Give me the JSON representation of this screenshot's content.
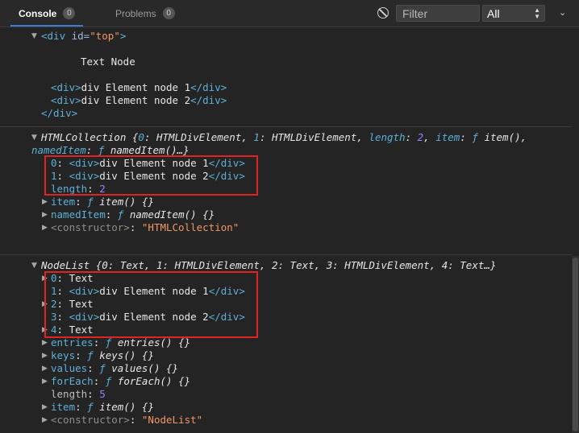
{
  "toolbar": {
    "console_label": "Console",
    "console_count": "0",
    "problems_label": "Problems",
    "problems_count": "0",
    "filter_placeholder": "Filter",
    "level_value": "All"
  },
  "entry1": {
    "line1_tag_open": "<div",
    "line1_attr": " id=",
    "line1_val": "\"top\"",
    "line1_close": ">",
    "text_node": "Text Node",
    "child1_open": "<div>",
    "child1_text": "div Element node 1",
    "child1_close": "</div>",
    "child2_open": "<div>",
    "child2_text": "div Element node 2",
    "child2_close": "</div>",
    "end_tag": "</div>"
  },
  "entry2": {
    "summary_a": "HTMLCollection {",
    "summary_b": "0",
    "summary_c": ": HTMLDivElement, ",
    "summary_d": "1",
    "summary_e": ": HTMLDivElement, ",
    "summary_f": "length",
    "summary_g": ": ",
    "summary_h": "2",
    "summary_i": ", ",
    "summary_j": "item",
    "summary_k": ": ",
    "summary_l": "ƒ",
    "summary_m": " item(),",
    "summary2_a": "namedItem",
    "summary2_b": ": ",
    "summary2_c": "ƒ",
    "summary2_d": " namedItem()…}",
    "items": [
      {
        "key": "0",
        "open": "<div>",
        "text": "div Element node 1",
        "close": "</div>"
      },
      {
        "key": "1",
        "open": "<div>",
        "text": "div Element node 2",
        "close": "</div>"
      }
    ],
    "length_key": "length",
    "length_val": "2",
    "item_key": "item",
    "item_val": "item() {}",
    "named_key": "namedItem",
    "named_val": "namedItem() {}",
    "ctor_key": "<constructor>",
    "ctor_val": "\"HTMLCollection\"",
    "f": "ƒ"
  },
  "entry3": {
    "summary": "NodeList {0: Text, 1: HTMLDivElement, 2: Text, 3: HTMLDivElement, 4: Text…}",
    "items": [
      {
        "key": "0",
        "text": "Text"
      },
      {
        "key": "1",
        "open": "<div>",
        "text": "div Element node 1",
        "close": "</div>"
      },
      {
        "key": "2",
        "text": "Text"
      },
      {
        "key": "3",
        "open": "<div>",
        "text": "div Element node 2",
        "close": "</div>"
      },
      {
        "key": "4",
        "text": "Text"
      }
    ],
    "entries_key": "entries",
    "entries_val": "entries() {}",
    "keys_key": "keys",
    "keys_val": "keys() {}",
    "values_key": "values",
    "values_val": "values() {}",
    "foreach_key": "forEach",
    "foreach_val": "forEach() {}",
    "length_key": "length",
    "length_val": "5",
    "item_key": "item",
    "item_val": "item() {}",
    "ctor_key": "<constructor>",
    "ctor_val": "\"NodeList\"",
    "f": "ƒ"
  },
  "colors": {
    "highlight": "#e02424",
    "accent": "#3a7bd5"
  }
}
